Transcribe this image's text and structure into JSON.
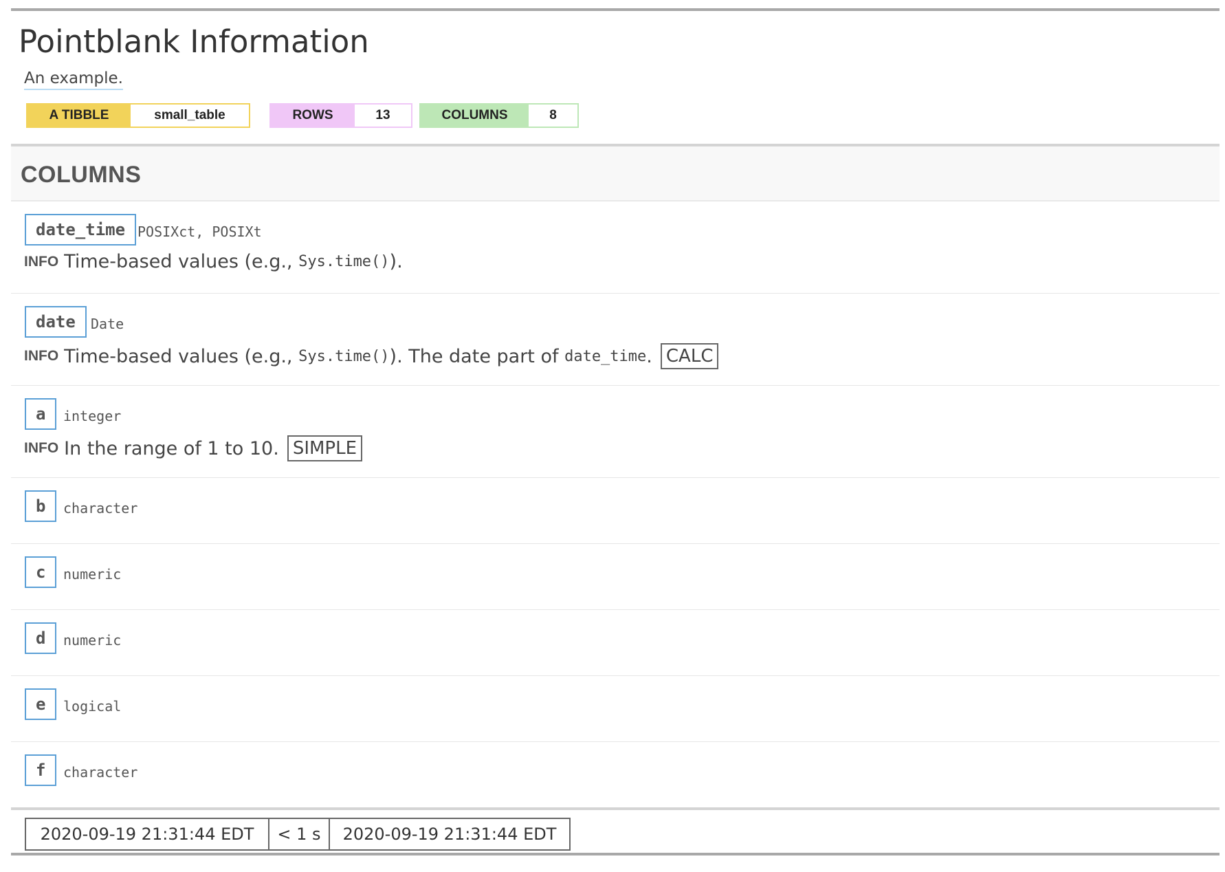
{
  "header": {
    "title": "Pointblank Information",
    "subtitle": "An example.",
    "badges": {
      "tibble_label": "A TIBBLE",
      "tibble_value": "small_table",
      "rows_label": "ROWS",
      "rows_value": "13",
      "columns_label": "COLUMNS",
      "columns_value": "8"
    },
    "colors": {
      "tibble": "#f2d35a",
      "rows": "#f0c7f7",
      "columns": "#bde7b6"
    }
  },
  "section": {
    "title": "COLUMNS"
  },
  "info_label": "INFO",
  "columns": [
    {
      "name": "date_time",
      "type": "POSIXct, POSIXt",
      "info": {
        "pre": "Time-based values (e.g., ",
        "code": "Sys.time()",
        "post": ")."
      }
    },
    {
      "name": "date",
      "type": "Date",
      "info": {
        "pre": "Time-based values (e.g., ",
        "code": "Sys.time()",
        "post": "). The date part of ",
        "code2": "date_time",
        "post2": ".",
        "tag": "CALC"
      }
    },
    {
      "name": "a",
      "type": "integer",
      "info": {
        "text": "In the range of 1 to 10.",
        "tag": "SIMPLE"
      }
    },
    {
      "name": "b",
      "type": "character"
    },
    {
      "name": "c",
      "type": "numeric"
    },
    {
      "name": "d",
      "type": "numeric"
    },
    {
      "name": "e",
      "type": "logical"
    },
    {
      "name": "f",
      "type": "character"
    }
  ],
  "footer": {
    "start_time": "2020-09-19 21:31:44 EDT",
    "duration": "< 1 s",
    "end_time": "2020-09-19 21:31:44 EDT"
  },
  "accent_color": "#5a9fd6"
}
